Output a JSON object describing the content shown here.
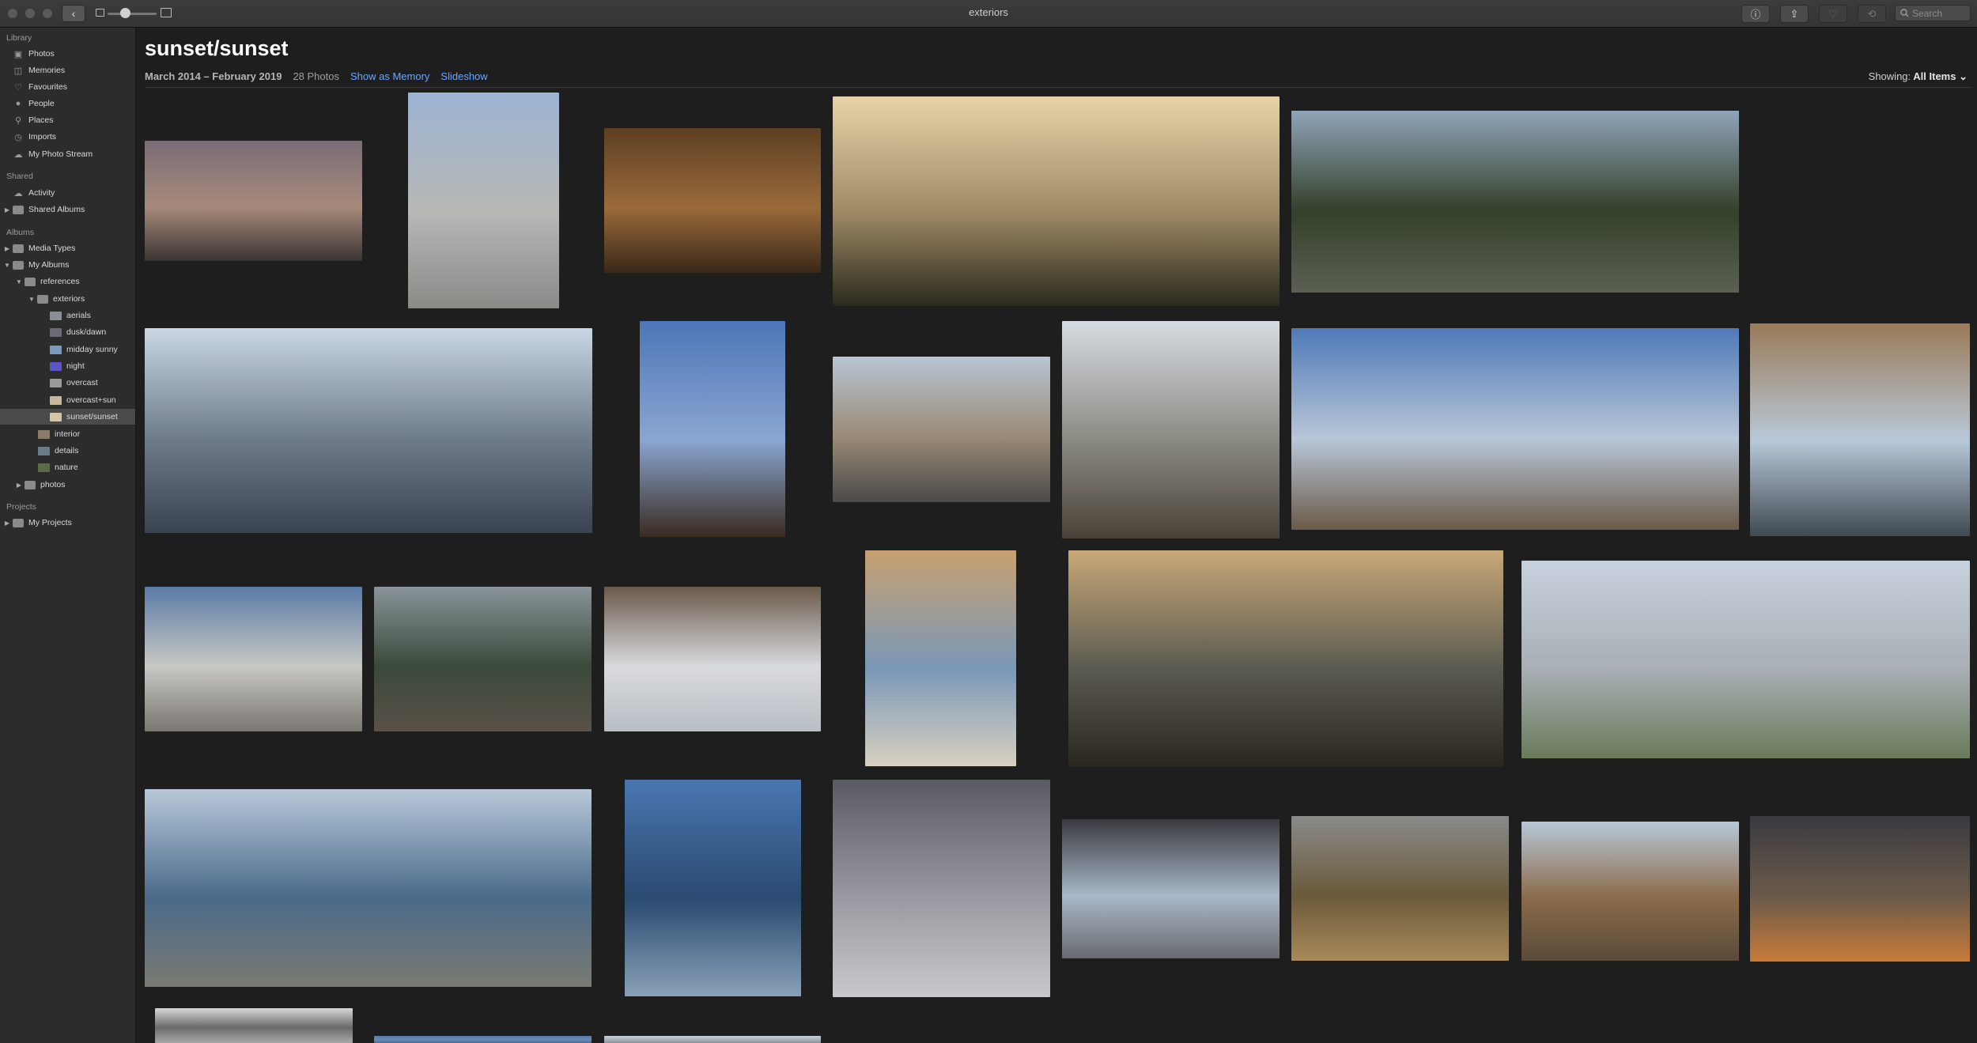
{
  "window": {
    "title": "exteriors",
    "search_placeholder": "Search",
    "back_glyph": "‹"
  },
  "toolbar": {
    "info_glyph": "ⓘ",
    "share_glyph": "⇪",
    "favorite_glyph": "♡",
    "rotate_glyph": "⟲"
  },
  "sidebar": {
    "library_header": "Library",
    "library_items": [
      {
        "label": "Photos",
        "icon": "photos-icon",
        "glyph": "▣"
      },
      {
        "label": "Memories",
        "icon": "memories-icon",
        "glyph": "◫"
      },
      {
        "label": "Favourites",
        "icon": "heart-icon",
        "glyph": "♡"
      },
      {
        "label": "People",
        "icon": "person-icon",
        "glyph": "●"
      },
      {
        "label": "Places",
        "icon": "pin-icon",
        "glyph": "⚲"
      },
      {
        "label": "Imports",
        "icon": "clock-icon",
        "glyph": "◷"
      },
      {
        "label": "My Photo Stream",
        "icon": "cloud-icon",
        "glyph": "☁"
      }
    ],
    "shared_header": "Shared",
    "shared_items": [
      {
        "label": "Activity",
        "icon": "cloud-icon",
        "glyph": "☁"
      },
      {
        "label": "Shared Albums",
        "icon": "folder-icon"
      }
    ],
    "albums_header": "Albums",
    "album_tree": {
      "media_types": "Media Types",
      "my_albums": "My Albums",
      "references": "references",
      "exteriors": "exteriors",
      "sub_albums": [
        {
          "label": "aerials",
          "color": "#8a8f96"
        },
        {
          "label": "dusk/dawn",
          "color": "#6d6a74"
        },
        {
          "label": "midday sunny",
          "color": "#7a9ac0"
        },
        {
          "label": "night",
          "color": "#5a56c8"
        },
        {
          "label": "overcast",
          "color": "#9a9a9a"
        },
        {
          "label": "overcast+sun",
          "color": "#c9b79a"
        },
        {
          "label": "sunset/sunset",
          "color": "#d6c6a8"
        }
      ],
      "interior": "interior",
      "details": "details",
      "nature": "nature",
      "photos": "photos"
    },
    "projects_header": "Projects",
    "my_projects": "My Projects",
    "expand_glyph": "▶",
    "collapse_glyph": "▼"
  },
  "header": {
    "title": "sunset/sunset",
    "date_range": "March 2014 – February 2019",
    "photo_count": "28 Photos",
    "show_as_memory": "Show as Memory",
    "slideshow": "Slideshow",
    "showing_label": "Showing:",
    "showing_value": "All Items",
    "chevron": "⌄"
  },
  "photos": [
    {
      "subject": "concrete tower at dusk with garden",
      "colors": [
        "#7a6d78",
        "#a78a7a",
        "#3a3433"
      ]
    },
    {
      "subject": "concrete cube tower on blue sky",
      "colors": [
        "#9cb3d3",
        "#b8b8b6",
        "#8a8a87"
      ]
    },
    {
      "subject": "timber roof barn interior",
      "colors": [
        "#5d3f22",
        "#9a6a3a",
        "#3a2818"
      ]
    },
    {
      "subject": "sun over grassy hills",
      "colors": [
        "#e8d2a8",
        "#a08a66",
        "#2a2a1c"
      ]
    },
    {
      "subject": "dark pavilion in pine forest at dusk",
      "colors": [
        "#8fa4b8",
        "#34402a",
        "#5a6052"
      ]
    },
    {
      "subject": "waterfront apartments by the sea",
      "colors": [
        "#c9d6e4",
        "#6d7a88",
        "#3a4350"
      ]
    },
    {
      "subject": "brick tower under blue sky",
      "colors": [
        "#4d76b8",
        "#8aa6d2",
        "#3a2b22"
      ]
    },
    {
      "subject": "silo building conversion",
      "colors": [
        "#b8c6d4",
        "#9a8a76",
        "#4a4a4a"
      ]
    },
    {
      "subject": "white villas on stone wall",
      "colors": [
        "#d6dce2",
        "#8a8a82",
        "#4a4238"
      ]
    },
    {
      "subject": "circular arena with fins",
      "colors": [
        "#4f7ab8",
        "#b8c6d8",
        "#6a5a48"
      ]
    },
    {
      "subject": "wooden slatted facade and stairs",
      "colors": [
        "#9a7a58",
        "#b8c8d8",
        "#404a52"
      ]
    },
    {
      "subject": "perforated facade over city",
      "colors": [
        "#5a7aa6",
        "#c8c8c4",
        "#7a7670"
      ]
    },
    {
      "subject": "misty forest pavilion",
      "colors": [
        "#8a949a",
        "#3a4a3a",
        "#5a5048"
      ]
    },
    {
      "subject": "white figure in misty terrace",
      "colors": [
        "#6a5a4a",
        "#d8dade",
        "#b8bec4"
      ]
    },
    {
      "subject": "curved white canopy",
      "colors": [
        "#c8a070",
        "#7a98b8",
        "#d8d0c0"
      ]
    },
    {
      "subject": "lantern tower at misty sunrise",
      "colors": [
        "#c8a878",
        "#5a5a50",
        "#2a2620"
      ]
    },
    {
      "subject": "white building with plaza",
      "colors": [
        "#c8d2de",
        "#a8aeb4",
        "#6a7a5a"
      ]
    },
    {
      "subject": "blue pixel facade buildings",
      "colors": [
        "#b8c8da",
        "#4a6a8a",
        "#7a7a72"
      ]
    },
    {
      "subject": "checkered blue facade",
      "colors": [
        "#4a76b0",
        "#2a4a70",
        "#8aa0b8"
      ]
    },
    {
      "subject": "lattice dome interior",
      "colors": [
        "#5a5a62",
        "#9a9aa2",
        "#c8c8cc"
      ]
    },
    {
      "subject": "arched gridshell opening",
      "colors": [
        "#3a3a40",
        "#a8b8c8",
        "#6a6a70"
      ]
    },
    {
      "subject": "mountain valley in autumn",
      "colors": [
        "#8a8a8a",
        "#6a5a3a",
        "#a88a5a"
      ]
    },
    {
      "subject": "glass pavilion in field",
      "colors": [
        "#b8c8d8",
        "#8a6a4a",
        "#5a4a3a"
      ]
    },
    {
      "subject": "timber slat shelter with fire pit",
      "colors": [
        "#3a3a40",
        "#6a5a4a",
        "#c87a3a"
      ]
    },
    {
      "subject": "tree branches and tower",
      "colors": [
        "#d8d8d8",
        "#6a6a6a",
        "#a8a8a8"
      ]
    },
    {
      "subject": "blue sky glimpse",
      "colors": [
        "#5a7aa6",
        "#6a8ab6",
        "#4a6a96"
      ]
    },
    {
      "subject": "pale sky glimpse",
      "colors": [
        "#c8d0d8",
        "#a8b0b8",
        "#8a9098"
      ]
    }
  ]
}
